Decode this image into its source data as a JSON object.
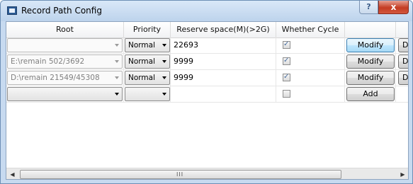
{
  "window": {
    "title": "Record Path Config",
    "help_glyph": "?",
    "close_glyph": "x"
  },
  "table": {
    "columns": [
      "Root",
      "Priority",
      "Reserve space(M)(>2G)",
      "Whether Cycle",
      "",
      ""
    ],
    "rows": [
      {
        "root": "",
        "priority": "Normal",
        "reserve": "22693",
        "cycle": "✓",
        "action": "Modify",
        "extra": "D"
      },
      {
        "root": "E:\\remain 502/3692",
        "priority": "Normal",
        "reserve": "9999",
        "cycle": "✓",
        "action": "Modify",
        "extra": "D"
      },
      {
        "root": "D:\\remain 21549/45308",
        "priority": "Normal",
        "reserve": "9999",
        "cycle": "✓",
        "action": "Modify",
        "extra": "D"
      },
      {
        "root": "",
        "priority": "",
        "reserve": "",
        "cycle": "",
        "action": "Add",
        "extra": ""
      }
    ]
  },
  "scrollbar": {
    "left_arrow": "◀",
    "right_arrow": "▶",
    "grip": "III"
  }
}
